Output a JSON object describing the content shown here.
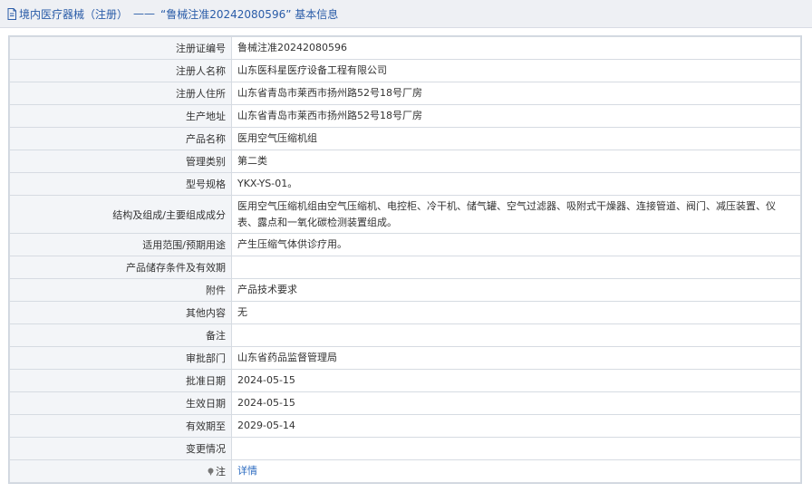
{
  "header": {
    "breadcrumb": "境内医疗器械（注册）",
    "separator": "——",
    "title": "“鲁械注准20242080596” 基本信息"
  },
  "rows": [
    {
      "label": "注册证编号",
      "value": "鲁械注准20242080596"
    },
    {
      "label": "注册人名称",
      "value": "山东医科星医疗设备工程有限公司"
    },
    {
      "label": "注册人住所",
      "value": "山东省青岛市莱西市扬州路52号18号厂房"
    },
    {
      "label": "生产地址",
      "value": "山东省青岛市莱西市扬州路52号18号厂房"
    },
    {
      "label": "产品名称",
      "value": "医用空气压缩机组"
    },
    {
      "label": "管理类别",
      "value": "第二类"
    },
    {
      "label": "型号规格",
      "value": "YKX-YS-01。"
    },
    {
      "label": "结构及组成/主要组成成分",
      "value": "医用空气压缩机组由空气压缩机、电控柜、冷干机、储气罐、空气过滤器、吸附式干燥器、连接管道、阀门、减压装置、仪表、露点和一氧化碳检测装置组成。"
    },
    {
      "label": "适用范围/预期用途",
      "value": "产生压缩气体供诊疗用。"
    },
    {
      "label": "产品储存条件及有效期",
      "value": ""
    },
    {
      "label": "附件",
      "value": "产品技术要求"
    },
    {
      "label": "其他内容",
      "value": "无"
    },
    {
      "label": "备注",
      "value": ""
    },
    {
      "label": "审批部门",
      "value": "山东省药品监督管理局"
    },
    {
      "label": "批准日期",
      "value": "2024-05-15"
    },
    {
      "label": "生效日期",
      "value": "2024-05-15"
    },
    {
      "label": "有效期至",
      "value": "2029-05-14"
    },
    {
      "label": "变更情况",
      "value": ""
    }
  ],
  "note_row": {
    "label": "注",
    "link": "详情"
  },
  "icons": {
    "doc": "document-icon",
    "pin": "pin-icon"
  },
  "colors": {
    "link": "#2a6ac0",
    "header_bg": "#eef0f4",
    "label_bg": "#f3f5f8"
  }
}
